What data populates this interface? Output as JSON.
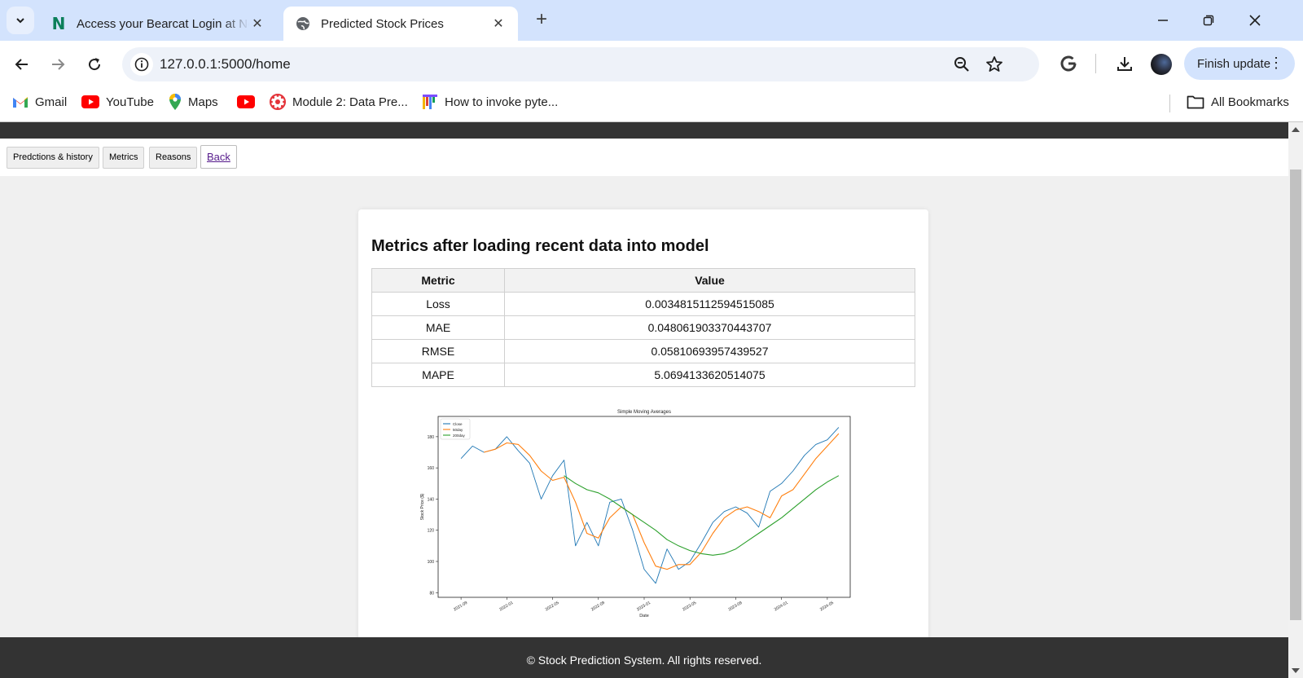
{
  "browser": {
    "tabs": [
      {
        "title": "Access your Bearcat Login at No",
        "active": false
      },
      {
        "title": "Predicted Stock Prices",
        "active": true
      }
    ],
    "url": "127.0.0.1:5000/home",
    "finish_update_label": "Finish update",
    "bookmarks": [
      {
        "label": "Gmail",
        "icon": "gmail-icon"
      },
      {
        "label": "YouTube",
        "icon": "youtube-icon"
      },
      {
        "label": "Maps",
        "icon": "maps-icon"
      },
      {
        "label": "",
        "icon": "youtube-icon"
      },
      {
        "label": "Module 2: Data Pre...",
        "icon": "canvas-icon"
      },
      {
        "label": "How to invoke pyte...",
        "icon": "jira-icon"
      }
    ],
    "all_bookmarks_label": "All Bookmarks"
  },
  "nav": {
    "predictions_label": "Predctions & history",
    "metrics_label": "Metrics",
    "reasons_label": "Reasons",
    "back_label": "Back"
  },
  "content": {
    "heading": "Metrics after loading recent data into model",
    "table": {
      "headers": [
        "Metric",
        "Value"
      ],
      "rows": [
        [
          "Loss",
          "0.0034815112594515085"
        ],
        [
          "MAE",
          "0.048061903370443707"
        ],
        [
          "RMSE",
          "0.05810693957439527"
        ],
        [
          "MAPE",
          "5.0694133620514075"
        ]
      ]
    }
  },
  "chart_data": {
    "type": "line",
    "title": "Simple Moving Averages",
    "xlabel": "Date",
    "ylabel": "Stock Price ($)",
    "x_ticks": [
      "2021-09",
      "2022-01",
      "2022-05",
      "2022-09",
      "2023-01",
      "2023-05",
      "2023-09",
      "2024-01",
      "2024-05"
    ],
    "y_ticks": [
      80,
      100,
      120,
      140,
      160,
      180
    ],
    "ylim": [
      77,
      193
    ],
    "legend_position": "top-left",
    "series": [
      {
        "name": "Close",
        "color": "#1f77b4",
        "x": [
          "2021-09",
          "2021-10",
          "2021-11",
          "2021-12",
          "2022-01",
          "2022-02",
          "2022-03",
          "2022-04",
          "2022-05",
          "2022-06",
          "2022-07",
          "2022-08",
          "2022-09",
          "2022-10",
          "2022-11",
          "2022-12",
          "2023-01",
          "2023-02",
          "2023-03",
          "2023-04",
          "2023-05",
          "2023-06",
          "2023-07",
          "2023-08",
          "2023-09",
          "2023-10",
          "2023-11",
          "2023-12",
          "2024-01",
          "2024-02",
          "2024-03",
          "2024-04",
          "2024-05",
          "2024-06"
        ],
        "values": [
          166,
          174,
          170,
          172,
          180,
          171,
          163,
          140,
          155,
          165,
          110,
          125,
          110,
          138,
          140,
          120,
          95,
          86,
          108,
          95,
          100,
          112,
          125,
          132,
          135,
          131,
          122,
          145,
          150,
          158,
          168,
          175,
          178,
          186
        ]
      },
      {
        "name": "50day",
        "color": "#ff7f0e",
        "x": [
          "2021-11",
          "2021-12",
          "2022-01",
          "2022-02",
          "2022-03",
          "2022-04",
          "2022-05",
          "2022-06",
          "2022-07",
          "2022-08",
          "2022-09",
          "2022-10",
          "2022-11",
          "2022-12",
          "2023-01",
          "2023-02",
          "2023-03",
          "2023-04",
          "2023-05",
          "2023-06",
          "2023-07",
          "2023-08",
          "2023-09",
          "2023-10",
          "2023-11",
          "2023-12",
          "2024-01",
          "2024-02",
          "2024-03",
          "2024-04",
          "2024-05",
          "2024-06"
        ],
        "values": [
          170,
          172,
          176,
          175,
          168,
          158,
          152,
          154,
          138,
          118,
          115,
          128,
          135,
          130,
          112,
          97,
          95,
          98,
          98,
          106,
          118,
          128,
          133,
          135,
          132,
          128,
          142,
          146,
          156,
          166,
          174,
          182
        ]
      },
      {
        "name": "200day",
        "color": "#2ca02c",
        "x": [
          "2022-06",
          "2022-07",
          "2022-08",
          "2022-09",
          "2022-10",
          "2022-11",
          "2022-12",
          "2023-01",
          "2023-02",
          "2023-03",
          "2023-04",
          "2023-05",
          "2023-06",
          "2023-07",
          "2023-08",
          "2023-09",
          "2023-10",
          "2023-11",
          "2023-12",
          "2024-01",
          "2024-02",
          "2024-03",
          "2024-04",
          "2024-05",
          "2024-06"
        ],
        "values": [
          155,
          150,
          146,
          144,
          140,
          135,
          130,
          125,
          120,
          114,
          110,
          107,
          105,
          104,
          105,
          108,
          113,
          118,
          123,
          128,
          134,
          140,
          146,
          151,
          155
        ]
      }
    ]
  },
  "footer": {
    "text": "© Stock Prediction System. All rights reserved."
  }
}
